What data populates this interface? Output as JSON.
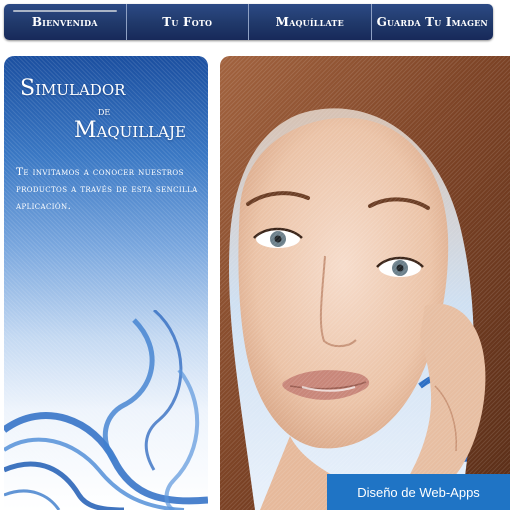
{
  "nav": {
    "items": [
      {
        "label": "Bienvenida",
        "active": true
      },
      {
        "label": "Tu Foto",
        "active": false
      },
      {
        "label": "Maquíllate",
        "active": false
      },
      {
        "label": "Guarda Tu Imagen",
        "active": false
      }
    ]
  },
  "intro": {
    "title_line1": "Simulador",
    "title_line2": "de",
    "title_line3": "Maquillaje",
    "description": "Te invitamos a conocer nuestros productos a través de esta sencilla aplicación."
  },
  "footer": {
    "credit_label": "Diseño de Web-Apps"
  },
  "colors": {
    "nav_blue": "#213a6c",
    "panel_blue": "#1b4fa0",
    "credit_button": "#1f74c5"
  }
}
